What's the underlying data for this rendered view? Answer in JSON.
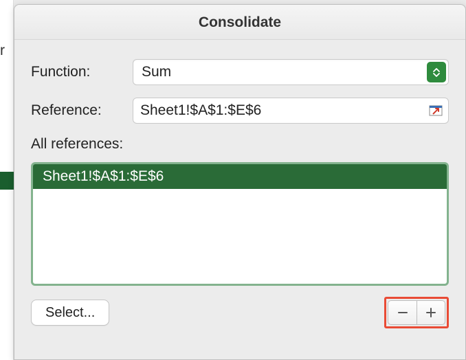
{
  "dialog": {
    "title": "Consolidate",
    "function_label": "Function:",
    "function_value": "Sum",
    "reference_label": "Reference:",
    "reference_value": "Sheet1!$A$1:$E$6",
    "allrefs_label": "All references:",
    "allrefs_items": [
      "Sheet1!$A$1:$E$6"
    ],
    "select_button": "Select...",
    "minus_label": "−",
    "plus_label": "+"
  },
  "backdrop": {
    "partial_char": "r"
  }
}
